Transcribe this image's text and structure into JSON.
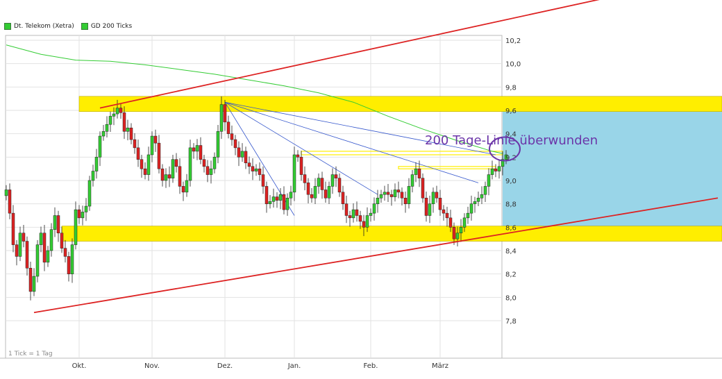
{
  "legend": {
    "items": [
      {
        "label": "Dt. Telekom (Xetra)",
        "color": "#33cc33"
      },
      {
        "label": "GD 200 Ticks",
        "color": "#33cc33"
      }
    ]
  },
  "footer_note": "1 Tick = 1 Tag",
  "annotation": "200 Tage-Linie überwunden",
  "colors": {
    "up": "#33cc33",
    "down": "#dd2222",
    "ma": "#33cc33",
    "channel": "#dd2222",
    "zone": "#ffee00",
    "target_zone": "#99d5e8",
    "fan": "#3355cc",
    "marker": "#6b35a8"
  },
  "chart_data": {
    "type": "candlestick",
    "title": "",
    "xlabel": "",
    "ylabel": "",
    "ylim": [
      7.7,
      10.3
    ],
    "x_range": [
      0,
      143
    ],
    "yticks": [
      "7,8",
      "8,0",
      "8,2",
      "8,4",
      "8,6",
      "8,8",
      "9,0",
      "9,2",
      "9,4",
      "9,6",
      "9,8",
      "10,0",
      "10,2"
    ],
    "ytick_values": [
      7.8,
      8.0,
      8.2,
      8.4,
      8.6,
      8.8,
      9.0,
      9.2,
      9.4,
      9.6,
      9.8,
      10.0,
      10.2
    ],
    "xticks": [
      {
        "label": "Okt.",
        "index": 21
      },
      {
        "label": "Nov.",
        "index": 42
      },
      {
        "label": "Dez.",
        "index": 63
      },
      {
        "label": "Jan.",
        "index": 83
      },
      {
        "label": "Feb.",
        "index": 105
      },
      {
        "label": "März",
        "index": 125
      }
    ],
    "grid": true,
    "legend_position": "top-left",
    "closes": [
      8.92,
      8.72,
      8.45,
      8.35,
      8.55,
      8.48,
      8.25,
      8.05,
      8.18,
      8.45,
      8.55,
      8.3,
      8.4,
      8.58,
      8.7,
      8.55,
      8.42,
      8.35,
      8.2,
      8.45,
      8.75,
      8.68,
      8.73,
      8.78,
      9.0,
      9.08,
      9.2,
      9.38,
      9.42,
      9.48,
      9.55,
      9.57,
      9.62,
      9.58,
      9.42,
      9.45,
      9.35,
      9.28,
      9.18,
      9.1,
      9.05,
      9.22,
      9.38,
      9.32,
      9.1,
      9.0,
      9.05,
      9.02,
      9.18,
      9.12,
      8.95,
      8.9,
      9.0,
      9.28,
      9.25,
      9.3,
      9.18,
      9.12,
      9.05,
      9.1,
      9.2,
      9.42,
      9.65,
      9.5,
      9.4,
      9.35,
      9.28,
      9.2,
      9.25,
      9.15,
      9.12,
      9.08,
      9.1,
      9.05,
      8.95,
      8.8,
      8.82,
      8.86,
      8.83,
      8.88,
      8.75,
      8.85,
      8.9,
      9.22,
      9.2,
      9.05,
      8.98,
      8.88,
      8.85,
      8.95,
      9.02,
      8.92,
      8.85,
      8.95,
      9.05,
      9.02,
      8.9,
      8.8,
      8.7,
      8.68,
      8.75,
      8.7,
      8.65,
      8.6,
      8.7,
      8.72,
      8.8,
      8.85,
      8.88,
      8.9,
      8.88,
      8.86,
      8.92,
      8.9,
      8.85,
      8.8,
      8.95,
      9.05,
      9.1,
      9.02,
      8.85,
      8.7,
      8.8,
      8.9,
      8.85,
      8.75,
      8.72,
      8.68,
      8.6,
      8.5,
      8.55,
      8.6,
      8.68,
      8.72,
      8.8,
      8.82,
      8.85,
      8.88,
      8.95,
      9.05,
      9.1,
      9.08,
      9.12,
      9.18,
      9.22
    ],
    "ma200": [
      {
        "i": 0,
        "v": 10.16
      },
      {
        "i": 10,
        "v": 10.08
      },
      {
        "i": 20,
        "v": 10.03
      },
      {
        "i": 30,
        "v": 10.02
      },
      {
        "i": 40,
        "v": 9.99
      },
      {
        "i": 50,
        "v": 9.95
      },
      {
        "i": 60,
        "v": 9.91
      },
      {
        "i": 70,
        "v": 9.86
      },
      {
        "i": 80,
        "v": 9.81
      },
      {
        "i": 90,
        "v": 9.75
      },
      {
        "i": 100,
        "v": 9.67
      },
      {
        "i": 110,
        "v": 9.55
      },
      {
        "i": 120,
        "v": 9.44
      },
      {
        "i": 130,
        "v": 9.34
      },
      {
        "i": 140,
        "v": 9.25
      },
      {
        "i": 143,
        "v": 9.23
      }
    ],
    "channel_lines": [
      {
        "from": {
          "i": 27,
          "v": 9.62
        },
        "to": {
          "i": 205,
          "v": 10.77
        }
      },
      {
        "from": {
          "i": 8,
          "v": 7.87
        },
        "to": {
          "i": 205,
          "v": 8.85
        }
      }
    ],
    "support_zones": [
      {
        "from_i": 21,
        "v_low": 9.59,
        "v_high": 9.72
      },
      {
        "from_i": 16,
        "v_low": 8.48,
        "v_high": 8.61
      }
    ],
    "target_zone": {
      "from_i": 143,
      "v_low": 8.61,
      "v_high": 9.59
    },
    "fan_lines": [
      {
        "from": {
          "i": 63,
          "v": 9.67
        },
        "to": {
          "i": 83,
          "v": 8.7
        }
      },
      {
        "from": {
          "i": 63,
          "v": 9.67
        },
        "to": {
          "i": 107,
          "v": 8.88
        }
      },
      {
        "from": {
          "i": 63,
          "v": 9.67
        },
        "to": {
          "i": 141,
          "v": 9.22
        }
      },
      {
        "from": {
          "i": 63,
          "v": 9.67
        },
        "to": {
          "i": 136,
          "v": 8.98
        }
      }
    ],
    "resistance_bands": [
      {
        "from_i": 85,
        "to_i": 143,
        "v_low": 9.22,
        "v_high": 9.25
      },
      {
        "from_i": 113,
        "to_i": 141,
        "v_low": 9.1,
        "v_high": 9.12
      }
    ],
    "marker": {
      "i": 143,
      "v": 9.27
    }
  }
}
